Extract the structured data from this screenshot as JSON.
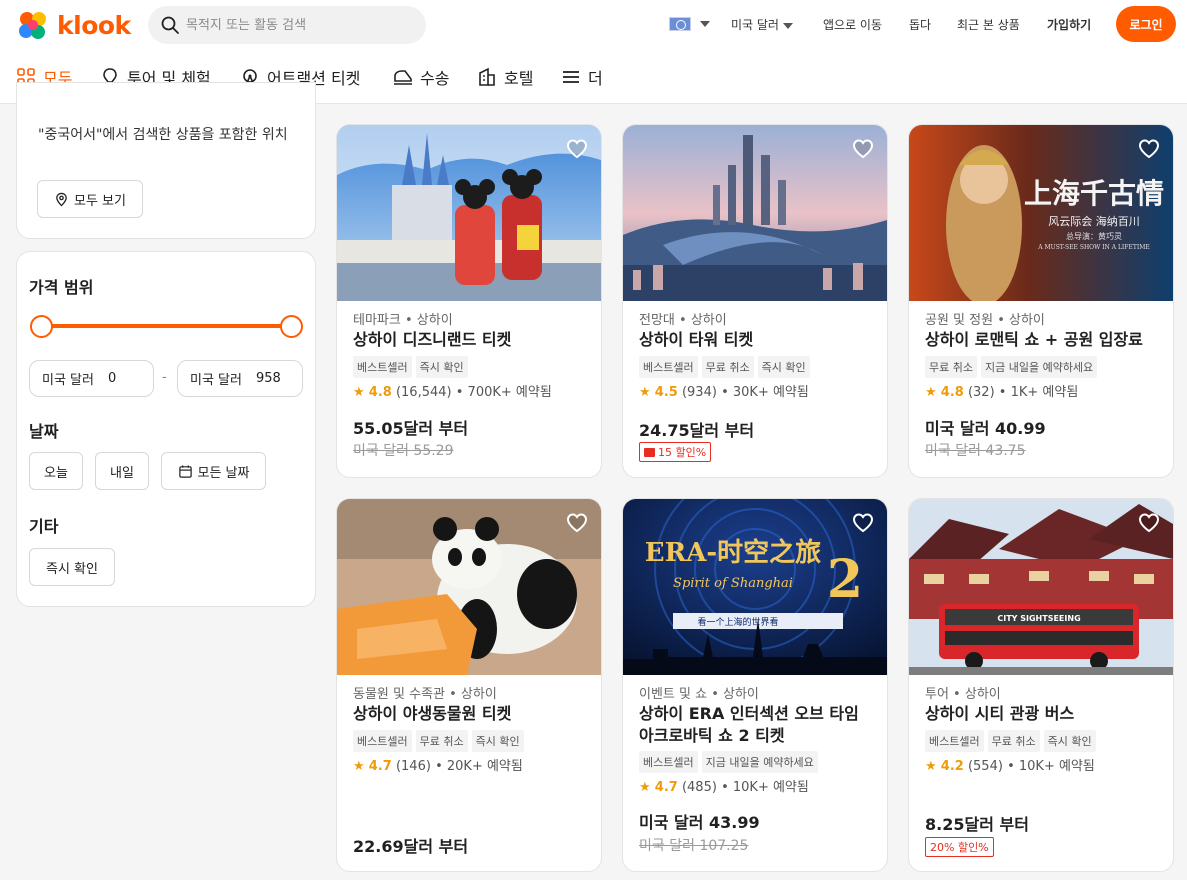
{
  "header": {
    "logo_text": "klook",
    "search_placeholder": "목적지 또는 활동 검색",
    "currency": "미국 달러",
    "app_link": "앱으로 이동",
    "help": "돕다",
    "recent": "최근 본 상품",
    "signup": "가입하기",
    "login": "로그인"
  },
  "tabs": [
    {
      "label": "모두",
      "icon": "grid-icon"
    },
    {
      "label": "투어 및 체험",
      "icon": "balloon-icon"
    },
    {
      "label": "어트랙션 티켓",
      "icon": "ferris-wheel-icon"
    },
    {
      "label": "수송",
      "icon": "train-icon"
    },
    {
      "label": "호텔",
      "icon": "hotel-icon"
    },
    {
      "label": "더",
      "icon": "menu-icon"
    }
  ],
  "sidebar": {
    "location_text": "\"중국어서\"에서 검색한 상품을 포함한 위치",
    "view_all": "모두 보기",
    "price_title": "가격 범위",
    "price_min_label": "미국 달러",
    "price_min_value": "0",
    "price_max_label": "미국 달러",
    "price_max_value": "958",
    "price_separator": "-",
    "date_title": "날짜",
    "date_today": "오늘",
    "date_tomorrow": "내일",
    "date_all": "모든 날짜",
    "other_title": "기타",
    "instant_confirm": "즉시 확인"
  },
  "cards": [
    {
      "category": "테마파크 • 상하이",
      "title": "상하이 디즈니랜드 티켓",
      "tags": [
        "베스트셀러",
        "즉시 확인"
      ],
      "score": "4.8",
      "reviews": "(16,544)",
      "booked": "• 700K+ 예약됨",
      "price": "55.05달러 부터",
      "old_price": "미국 달러 55.29",
      "discount": ""
    },
    {
      "category": "전망대 • 상하이",
      "title": "상하이 타워 티켓",
      "tags": [
        "베스트셀러",
        "무료 취소",
        "즉시 확인"
      ],
      "score": "4.5",
      "reviews": "(934)",
      "booked": "• 30K+ 예약됨",
      "price": "24.75달러 부터",
      "old_price": "",
      "discount": "15 할인%"
    },
    {
      "category": "공원 및 정원 • 상하이",
      "title": "상하이 로맨틱 쇼 + 공원 입장료",
      "tags": [
        "무료 취소",
        "지금 내일을 예약하세요"
      ],
      "score": "4.8",
      "reviews": "(32)",
      "booked": "• 1K+ 예약됨",
      "price": "미국 달러 40.99",
      "old_price": "미국 달러 43.75",
      "discount": "",
      "image_title": "上海千古情",
      "image_subtitle": "风云际会 海纳百川",
      "image_director": "总导演：黄巧灵",
      "image_tagline": "A MUST-SEE SHOW IN A LIFETIME"
    },
    {
      "category": "동물원 및 수족관 • 상하이",
      "title": "상하이 야생동물원 티켓",
      "tags": [
        "베스트셀러",
        "무료 취소",
        "즉시 확인"
      ],
      "score": "4.7",
      "reviews": "(146)",
      "booked": "• 20K+ 예약됨",
      "price": "22.69달러 부터",
      "old_price": "",
      "discount": ""
    },
    {
      "category": "이벤트 및 쇼 • 상하이",
      "title": "상하이 ERA 인터섹션 오브 타임 아크로바틱 쇼 2 티켓",
      "tags": [
        "베스트셀러",
        "지금 내일을 예약하세요"
      ],
      "score": "4.7",
      "reviews": "(485)",
      "booked": "• 10K+ 예약됨",
      "price": "미국 달러 43.99",
      "old_price": "미국 달러 107.25",
      "discount": "",
      "image_title": "ERA-时空之旅",
      "image_number": "2",
      "image_subtitle": "Spirit of Shanghai",
      "image_banner": "看一个上海的世界看"
    },
    {
      "category": "투어 • 상하이",
      "title": "상하이 시티 관광 버스",
      "tags": [
        "베스트셀러",
        "무료 취소",
        "즉시 확인"
      ],
      "score": "4.2",
      "reviews": "(554)",
      "booked": "• 10K+ 예약됨",
      "price": "8.25달러 부터",
      "old_price": "",
      "discount": "20% 할인%",
      "image_bus_text": "CITY SIGHTSEEING"
    }
  ],
  "colors": {
    "brand": "#ff5b00",
    "star": "#f09b0a",
    "discount": "#e62d20"
  }
}
